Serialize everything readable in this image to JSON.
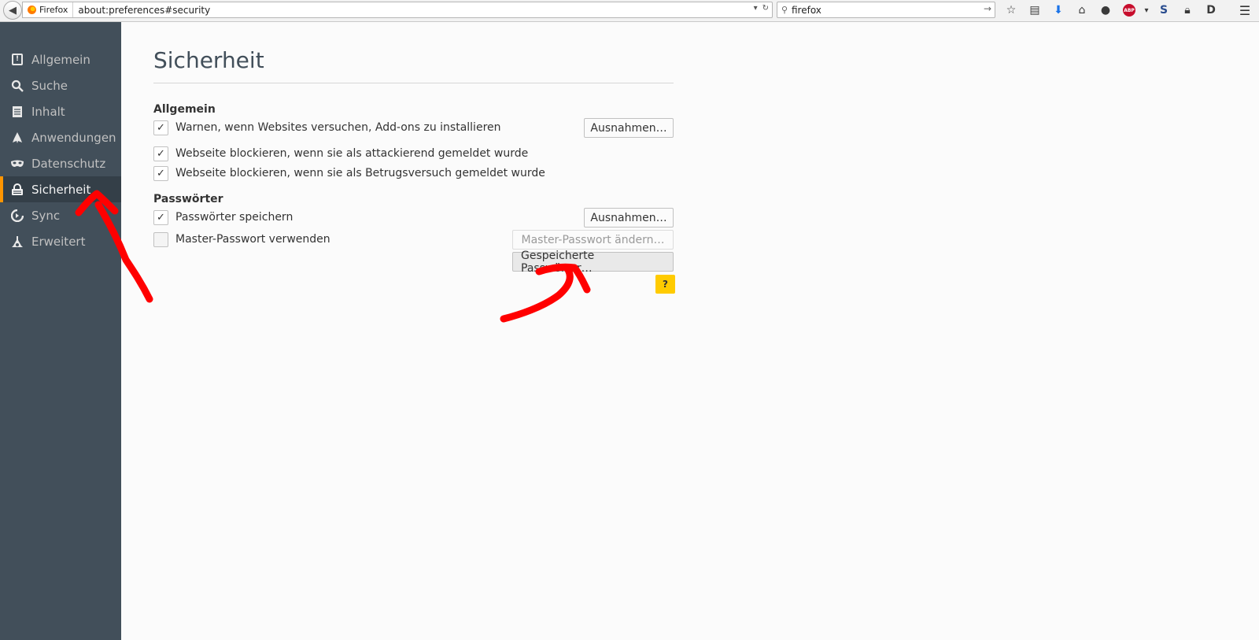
{
  "browser": {
    "identity_label": "Firefox",
    "url": "about:preferences#security",
    "search_value": "firefox"
  },
  "sidebar": {
    "items": [
      {
        "label": "Allgemein",
        "icon": "general-icon"
      },
      {
        "label": "Suche",
        "icon": "search-icon"
      },
      {
        "label": "Inhalt",
        "icon": "content-icon"
      },
      {
        "label": "Anwendungen",
        "icon": "applications-icon"
      },
      {
        "label": "Datenschutz",
        "icon": "privacy-mask-icon"
      },
      {
        "label": "Sicherheit",
        "icon": "security-lock-icon",
        "selected": true
      },
      {
        "label": "Sync",
        "icon": "sync-icon"
      },
      {
        "label": "Erweitert",
        "icon": "advanced-icon"
      }
    ]
  },
  "main": {
    "title": "Sicherheit",
    "general": {
      "heading": "Allgemein",
      "warn_addons": "Warnen, wenn Websites versuchen, Add-ons zu installieren",
      "exceptions_label": "Ausnahmen…",
      "block_attack": "Webseite blockieren, wenn sie als attackierend gemeldet wurde",
      "block_forgery": "Webseite blockieren, wenn sie als Betrugsversuch gemeldet wurde"
    },
    "passwords": {
      "heading": "Passwörter",
      "save_passwords": "Passwörter speichern",
      "exceptions_label": "Ausnahmen…",
      "use_master": "Master-Passwort verwenden",
      "change_master_label": "Master-Passwort ändern…",
      "saved_passwords_label": "Gespeicherte Passwörter…"
    },
    "help_label": "?"
  },
  "colors": {
    "sidebar_bg": "#424f5a",
    "selected_accent": "#ff9500",
    "help_bg": "#ffcb00",
    "annotation": "#ff0000"
  }
}
